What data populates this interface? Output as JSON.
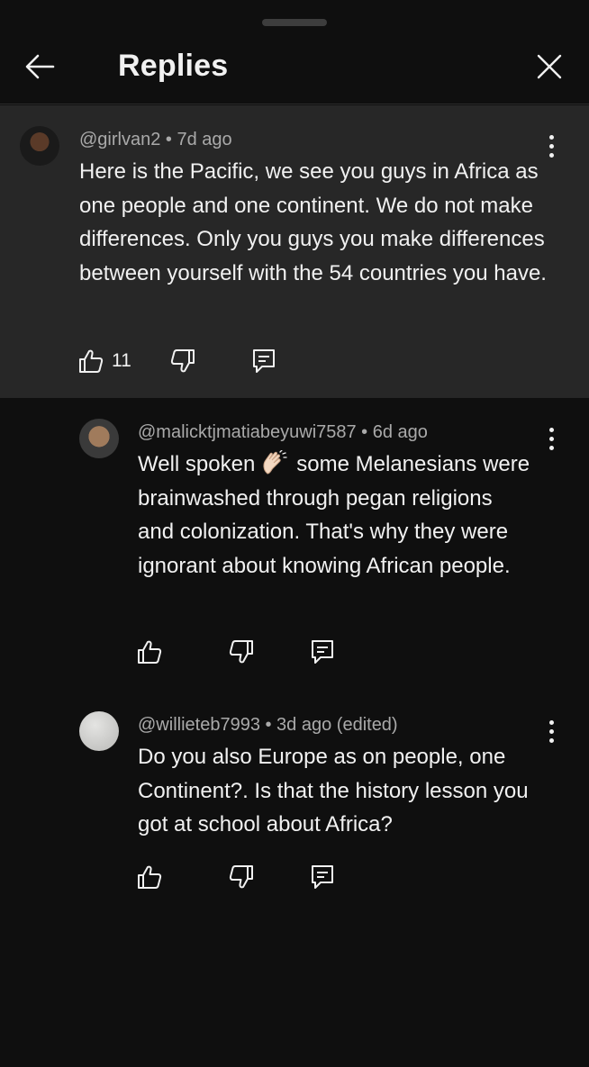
{
  "header": {
    "title": "Replies"
  },
  "icons": {
    "back": "arrow-left-icon",
    "close": "close-icon",
    "more": "vertical-ellipsis-icon",
    "like": "thumbs-up-icon",
    "dislike": "thumbs-down-icon",
    "reply": "comment-icon",
    "clap": "clapping-hands-emoji"
  },
  "colors": {
    "background": "#0f0f0f",
    "highlight": "#272727",
    "text": "#f1f1f1",
    "meta": "#aaaaaa"
  },
  "comments": [
    {
      "meta": "@girlvan2 • 7d ago",
      "text": "Here is the Pacific, we see you guys in Africa as one people and one continent. We do not make differences. Only you guys you make differences between yourself with the 54 countries you have.",
      "likes": "11"
    },
    {
      "meta": "@malicktjmatiabeyuwi7587 • 6d ago",
      "text_before_emoji": "Well spoken",
      "text_after_emoji": "some Melanesians were  brainwashed through pegan religions and colonization.  That's why they were ignorant about knowing African people."
    },
    {
      "meta": "@willieteb7993 • 3d ago (edited)",
      "text": "Do you also Europe as on people, one Continent?. Is that the history lesson you got at school about Africa?"
    }
  ]
}
